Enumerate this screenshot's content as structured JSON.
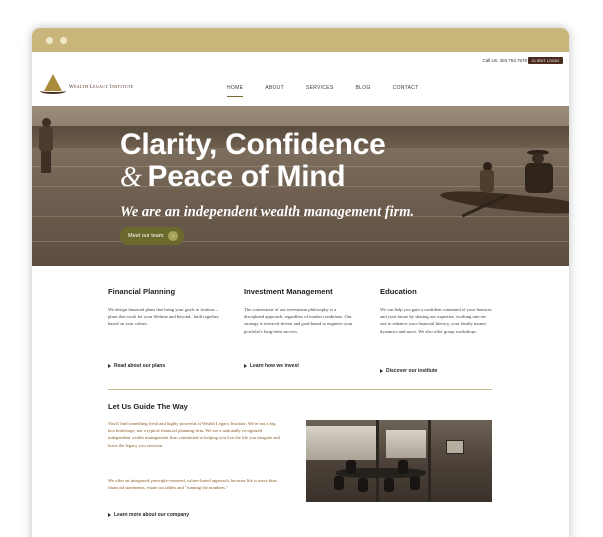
{
  "utility": {
    "call_text": "Call Us: 303.753.7578",
    "login_label": "CLIENT LOGIN"
  },
  "logo": {
    "text": "Wealth Legacy Institute"
  },
  "nav": {
    "items": [
      {
        "label": "HOME",
        "active": true
      },
      {
        "label": "ABOUT"
      },
      {
        "label": "SERVICES"
      },
      {
        "label": "BLOG"
      },
      {
        "label": "CONTACT"
      }
    ]
  },
  "hero": {
    "title_line1": "Clarity, Confidence",
    "title_amp": "&",
    "title_line2": "Peace of Mind",
    "subtitle": "We are an independent wealth management firm.",
    "button_label": "Meet our team",
    "button_arrow": "›",
    "prev_arrow": "‹",
    "next_arrow": "›"
  },
  "columns": [
    {
      "title": "Financial Planning",
      "body": "We design financial plans that bring your goals to fruition—plans that work for your lifetime and beyond– built together, based on your values.",
      "link": "Read about our plans"
    },
    {
      "title": "Investment Management",
      "body": "The cornerstone of our investment philosophy is a disciplined approach, regardless of market conditions. Our strategy is research-driven and goal-based to engineer your portfolio's long-term success.",
      "link": "Learn how we invest"
    },
    {
      "title": "Education",
      "body": "We can help you gain a confident command of your finances and your future by sharing our expertise, working one-on-one to enhance your financial literacy, your family money dynamics and more. We also offer group workshops.",
      "link": "Discover our institute"
    }
  ],
  "guide": {
    "title": "Let Us Guide The Way",
    "p1": "You'll find something fresh and highly powerful at Wealth Legacy Institute. We're not a big box brokerage, nor a typical financial planning firm. We are a nationally recognized independent wealth management firm committed to helping you live the life you imagine and leave the legacy you envision.",
    "p2": "We offer an integrated, principle-centered, values-based approach, because life is more than financial statements, estate tax tables and \"running the numbers.\"",
    "link": "Learn more about our company"
  },
  "colors": {
    "chrome": "#c8b67a",
    "accent_brown": "#4a2c1e",
    "gold": "#a98b3b",
    "button_olive": "#6b6a2c",
    "body_link_text": "#8a5a24"
  }
}
